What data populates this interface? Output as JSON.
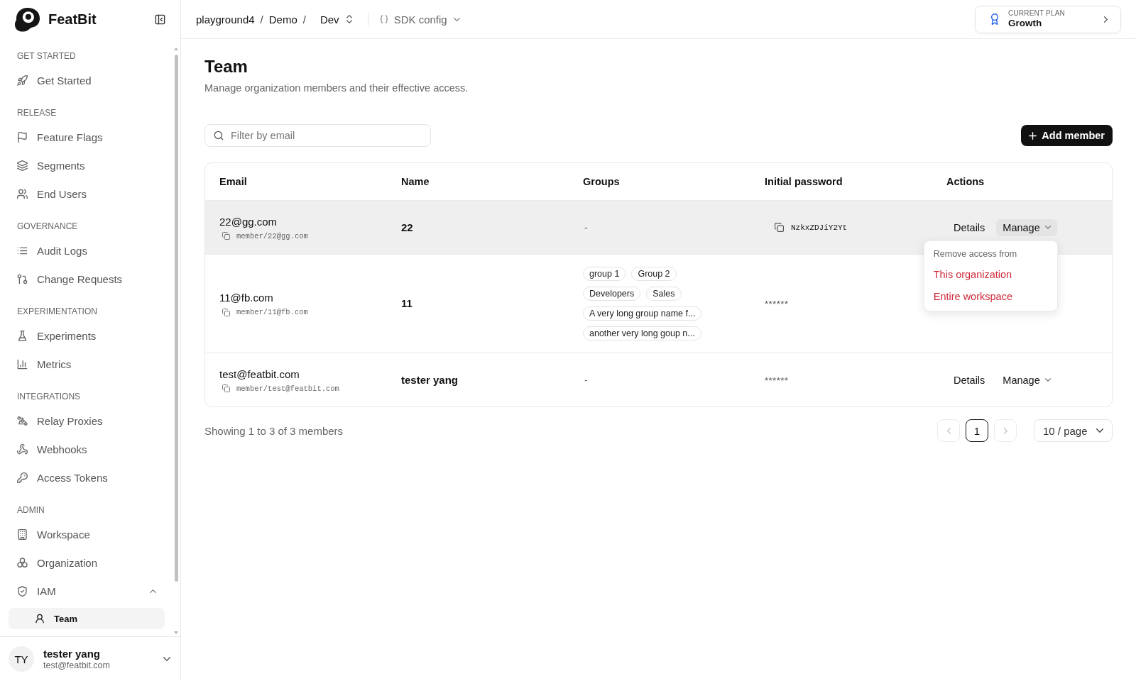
{
  "sidebar": {
    "brand": "FeatBit",
    "sections": [
      {
        "title": "GET STARTED",
        "items": [
          {
            "label": "Get Started",
            "selected": false
          }
        ]
      },
      {
        "title": "RELEASE",
        "items": [
          {
            "label": "Feature Flags",
            "selected": false
          },
          {
            "label": "Segments",
            "selected": false
          },
          {
            "label": "End Users",
            "selected": false
          }
        ]
      },
      {
        "title": "GOVERNANCE",
        "items": [
          {
            "label": "Audit Logs",
            "selected": false
          },
          {
            "label": "Change Requests",
            "selected": false
          }
        ]
      },
      {
        "title": "EXPERIMENTATION",
        "items": [
          {
            "label": "Experiments",
            "selected": false
          },
          {
            "label": "Metrics",
            "selected": false
          }
        ]
      },
      {
        "title": "INTEGRATIONS",
        "items": [
          {
            "label": "Relay Proxies",
            "selected": false
          },
          {
            "label": "Webhooks",
            "selected": false
          },
          {
            "label": "Access Tokens",
            "selected": false
          }
        ]
      },
      {
        "title": "ADMIN",
        "items": [
          {
            "label": "Workspace",
            "selected": false
          },
          {
            "label": "Organization",
            "selected": false
          },
          {
            "label": "IAM",
            "selected": false,
            "expanded": true,
            "children": [
              {
                "label": "Team",
                "selected": true
              }
            ]
          }
        ]
      }
    ],
    "user": {
      "initials": "TY",
      "name": "tester yang",
      "email": "test@featbit.com"
    }
  },
  "topbar": {
    "breadcrumb": [
      {
        "kind": "link",
        "text": "playground4"
      },
      {
        "kind": "separator",
        "text": "/"
      },
      {
        "kind": "link",
        "text": "Demo"
      },
      {
        "kind": "separator",
        "text": "/"
      },
      {
        "kind": "selector",
        "text": "Dev"
      }
    ],
    "sdk_config": {
      "label": "SDK config"
    },
    "plan": {
      "caption": "CURRENT PLAN",
      "name": "Growth"
    }
  },
  "page": {
    "title": "Team",
    "subtitle": "Manage organization members and their effective access."
  },
  "search": {
    "placeholder": "Filter by email"
  },
  "add_button": {
    "label": "Add member"
  },
  "table": {
    "columns": [
      "Email",
      "Name",
      "Groups",
      "Initial password",
      "Actions"
    ],
    "rows": [
      {
        "highlighted": true,
        "email": "22@gg.com",
        "member_id": "member/22@gg.com",
        "name": "22",
        "groups_text": "-",
        "password": {
          "kind": "copyable",
          "text": "NzkxZDJiY2Yt"
        },
        "actions": [
          {
            "kind": "link",
            "label": "Details"
          },
          {
            "kind": "menu",
            "label": "Manage",
            "expanded": true
          }
        ]
      },
      {
        "highlighted": false,
        "email": "11@fb.com",
        "member_id": "member/11@fb.com",
        "name": "11",
        "groups": [
          "group 1",
          "Group 2",
          "Developers",
          "Sales",
          "A very long group name f...",
          "another very long goup n..."
        ],
        "password": {
          "kind": "masked",
          "text": "******"
        }
      },
      {
        "highlighted": false,
        "email": "test@featbit.com",
        "member_id": "member/test@featbit.com",
        "name": "tester yang",
        "groups_text": "-",
        "password": {
          "kind": "masked",
          "text": "******"
        },
        "actions": [
          {
            "kind": "link",
            "label": "Details"
          },
          {
            "kind": "menu",
            "label": "Manage",
            "expanded": false
          }
        ]
      }
    ]
  },
  "manage_menu": {
    "heading": "Remove access from",
    "items": [
      "This organization",
      "Entire workspace"
    ]
  },
  "pagination": {
    "summary": "Showing 1 to 3 of 3 members",
    "previous": {
      "disabled": true
    },
    "pages": [
      {
        "label": "1",
        "selected": true
      }
    ],
    "next": {
      "disabled": true
    },
    "page_size": "10 / page"
  }
}
